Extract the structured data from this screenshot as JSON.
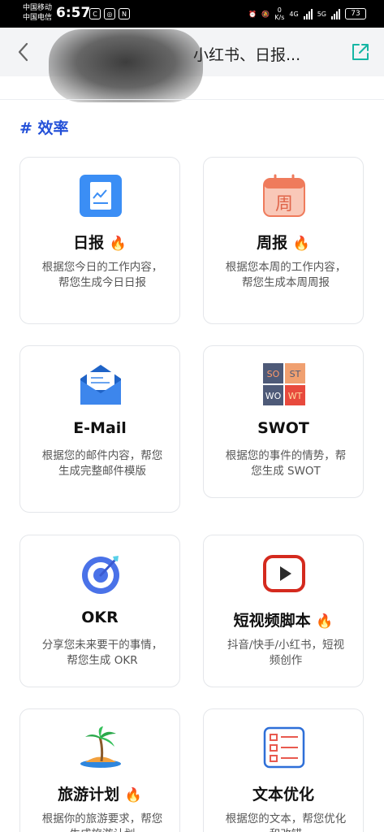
{
  "status_bar": {
    "carrier_1": "中国移动",
    "carrier_2": "中国电信",
    "time": "6:57",
    "net_speed_value": "0",
    "net_speed_unit": "K/s",
    "network_1": "4G",
    "network_2": "5G",
    "battery": "73"
  },
  "nav": {
    "title": "小红书、日报..."
  },
  "section": {
    "title": "# 效率"
  },
  "cards": [
    {
      "title": "日报",
      "hot": true,
      "fire": "🔥",
      "desc": "根据您今日的工作内容，帮您生成今日日报",
      "icon": "daily-report-icon"
    },
    {
      "title": "周报",
      "hot": true,
      "fire": "🔥",
      "desc": "根据您本周的工作内容，帮您生成本周周报",
      "icon": "calendar-week-icon"
    },
    {
      "title": "E-Mail",
      "hot": false,
      "fire": "",
      "desc": "根据您的邮件内容，帮您生成完整邮件模版",
      "icon": "mail-envelope-icon"
    },
    {
      "title": "SWOT",
      "hot": false,
      "fire": "",
      "desc": "根据您的事件的情势，帮您生成 SWOT",
      "icon": "swot-grid-icon"
    },
    {
      "title": "OKR",
      "hot": false,
      "fire": "",
      "desc": "分享您未来要干的事情，帮您生成 OKR",
      "icon": "target-icon"
    },
    {
      "title": "短视频脚本",
      "hot": true,
      "fire": "🔥",
      "desc": "抖音/快手/小红书，短视频创作",
      "icon": "video-play-icon"
    },
    {
      "title": "旅游计划",
      "hot": true,
      "fire": "🔥",
      "desc": "根据你的旅游要求，帮您生成旅游计划",
      "icon": "palm-island-icon"
    },
    {
      "title": "文本优化",
      "hot": false,
      "fire": "",
      "desc": "根据您的文本，帮您优化和改错",
      "icon": "text-list-icon"
    }
  ],
  "swot_labels": [
    "SO",
    "ST",
    "WO",
    "WT"
  ],
  "colors": {
    "accent": "#2350d8",
    "card_border": "#e4e6ea",
    "nav_bg": "#f3f4f6",
    "share_icon": "#16b6a4"
  }
}
